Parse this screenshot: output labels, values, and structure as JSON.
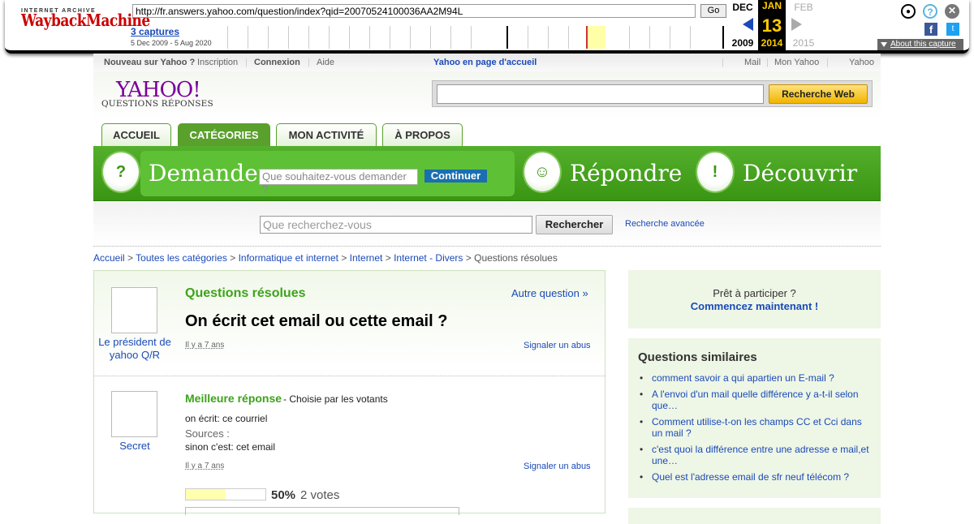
{
  "wayback": {
    "logo_top": "INTERNET ARCHIVE",
    "logo_main": "WaybackMachine",
    "url": "http://fr.answers.yahoo.com/question/index?qid=20070524100036AA2M94L",
    "go_label": "Go",
    "captures": "3 captures",
    "range": "5 Dec 2009 - 5 Aug 2020",
    "prev_month": "DEC",
    "cur_month": "JAN",
    "next_month": "FEB",
    "day": "13",
    "prev_year": "2009",
    "cur_year": "2014",
    "next_year": "2015",
    "about": "About this capture",
    "fb_glyph": "f",
    "tw_glyph": "t",
    "help_glyph": "?",
    "close_glyph": "✕",
    "user_glyph": "●"
  },
  "topnav": {
    "new_user": "Nouveau sur Yahoo ?",
    "signup": "Inscription",
    "login": "Connexion",
    "help": "Aide",
    "homepage": "Yahoo en page d'accueil",
    "mail": "Mail",
    "myyahoo": "Mon Yahoo",
    "yahoo": "Yahoo"
  },
  "header": {
    "logo": "YAHOO!",
    "logo_sub": "QUESTIONS RÉPONSES",
    "search_button": "Recherche Web"
  },
  "tabs": [
    "ACCUEIL",
    "CATÉGORIES",
    "MON ACTIVITÉ",
    "À PROPOS"
  ],
  "banner": {
    "ask": "Demander",
    "ask_placeholder": "Que souhaitez-vous demander ?",
    "continue": "Continuer",
    "answer": "Répondre",
    "discover": "Découvrir"
  },
  "search": {
    "placeholder": "Que recherchez-vous",
    "button": "Rechercher",
    "advanced": "Recherche avancée"
  },
  "breadcrumb": [
    "Accueil",
    "Toutes les catégories",
    "Informatique et internet",
    "Internet",
    "Internet - Divers",
    "Questions résolues"
  ],
  "question": {
    "section": "Questions résolues",
    "other": "Autre question »",
    "title": "On écrit cet email ou cette email ?",
    "asker": "Le président de yahoo Q/R",
    "ago": "Il y a 7 ans",
    "report": "Signaler un abus"
  },
  "answer": {
    "label": "Meilleure réponse",
    "sublabel": "- Choisie par les votants",
    "line1": "on écrit: ce courriel",
    "sources": "Sources :",
    "line2": "sinon c'est: cet email",
    "author": "Secret",
    "ago": "Il y a 7 ans",
    "report": "Signaler un abus",
    "vote_percent": "50%",
    "vote_fraction": 0.5,
    "votes": "2 votes"
  },
  "sidebar": {
    "ready": "Prêt à participer ?",
    "start": "Commencez maintenant !",
    "similar_title": "Questions similaires",
    "similar": [
      "comment savoir a qui apartien un E-mail ?",
      "A l'envoi d'un mail quelle différence y a-t-il selon que…",
      "Comment utilise-t-on les champs CC et Cci dans un mail ?",
      "c'est quoi la différence entre une adresse e mail,et une…",
      "Quel est l'adresse email de sfr neuf télécom ?"
    ]
  }
}
